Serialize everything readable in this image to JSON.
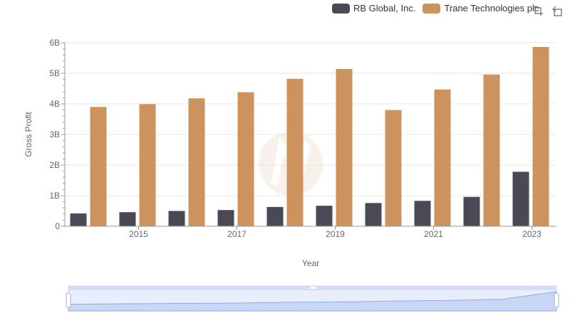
{
  "legend": {
    "items": [
      {
        "label": "RB Global, Inc.",
        "color": "#4a4a57"
      },
      {
        "label": "Trane Technologies plc",
        "color": "#cc935e"
      }
    ]
  },
  "toolbar": {
    "icons": [
      "crop-zoom-icon",
      "reset-zoom-icon"
    ]
  },
  "chart_data": {
    "type": "bar",
    "xlabel": "Year",
    "ylabel": "Gross Profit",
    "x_tick_labels": [
      "2015",
      "2017",
      "2019",
      "2021",
      "2023"
    ],
    "y_tick_labels": [
      "0",
      "1B",
      "2B",
      "3B",
      "4B",
      "5B",
      "6B"
    ],
    "ylim": [
      0,
      6000000000
    ],
    "categories": [
      "2014",
      "2015",
      "2016",
      "2017",
      "2018",
      "2019",
      "2020",
      "2021",
      "2022",
      "2023"
    ],
    "series": [
      {
        "name": "RB Global, Inc.",
        "color": "#4a4a57",
        "values": [
          420000000,
          460000000,
          500000000,
          530000000,
          630000000,
          670000000,
          760000000,
          830000000,
          960000000,
          1780000000
        ]
      },
      {
        "name": "Trane Technologies plc",
        "color": "#cc935e",
        "values": [
          3900000000,
          3990000000,
          4180000000,
          4380000000,
          4820000000,
          5140000000,
          3800000000,
          4470000000,
          4960000000,
          5860000000
        ]
      }
    ],
    "grid": true,
    "legend_position": "top-right"
  }
}
